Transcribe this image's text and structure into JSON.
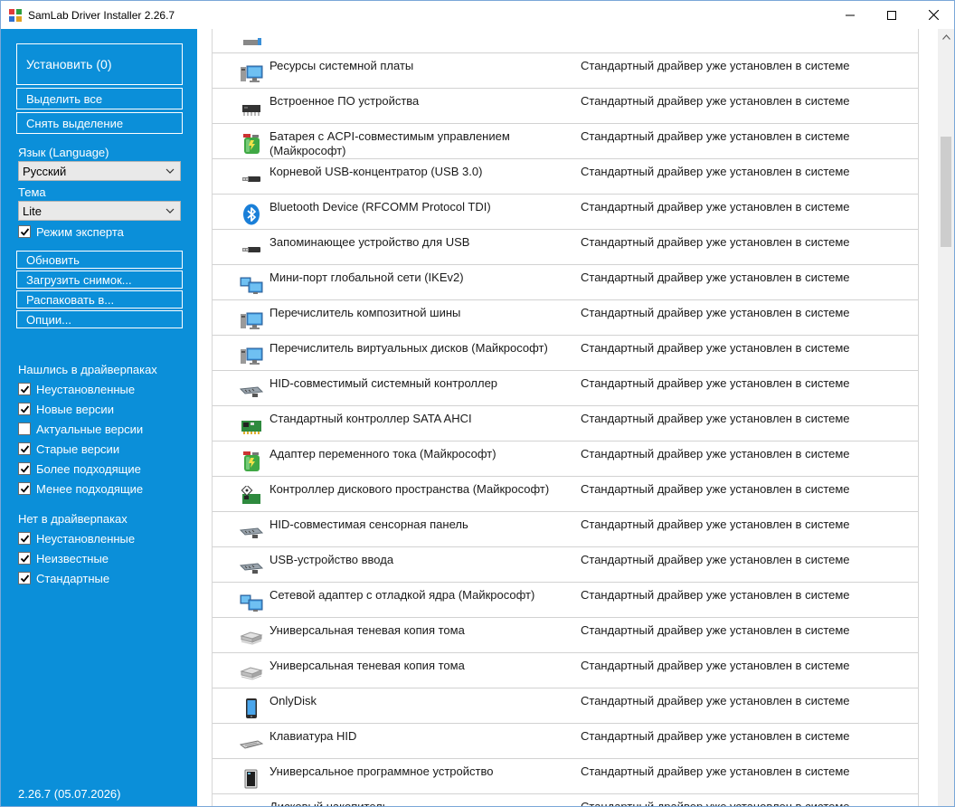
{
  "window": {
    "title": "SamLab Driver Installer 2.26.7"
  },
  "sidebar": {
    "install_label": "Установить (0)",
    "select_all_label": "Выделить все",
    "deselect_label": "Снять выделение",
    "language_label": "Язык (Language)",
    "language_value": "Русский",
    "theme_label": "Тема",
    "theme_value": "Lite",
    "expert_mode_label": "Режим эксперта",
    "refresh_label": "Обновить",
    "load_snapshot_label": "Загрузить снимок...",
    "extract_label": "Распаковать в...",
    "options_label": "Опции...",
    "found_header": "Нашлись в драйверпаках",
    "found_filters": [
      {
        "label": "Неустановленные",
        "checked": true
      },
      {
        "label": "Новые версии",
        "checked": true
      },
      {
        "label": "Актуальные версии",
        "checked": false
      },
      {
        "label": "Старые версии",
        "checked": true
      },
      {
        "label": "Более подходящие",
        "checked": true
      },
      {
        "label": "Менее подходящие",
        "checked": true
      }
    ],
    "notfound_header": "Нет в драйверпаках",
    "notfound_filters": [
      {
        "label": "Неустановленные",
        "checked": true
      },
      {
        "label": "Неизвестные",
        "checked": true
      },
      {
        "label": "Стандартные",
        "checked": true
      }
    ],
    "version": "2.26.7 (05.07.2026)"
  },
  "colors": {
    "sidebar_bg": "#0b8fd9",
    "row_border": "#d2d2d2"
  },
  "devices": [
    {
      "icon": "generic-device-icon",
      "name": "",
      "status": ""
    },
    {
      "icon": "computer-icon",
      "name": "Ресурсы системной платы",
      "status": "Стандартный драйвер уже установлен в системе"
    },
    {
      "icon": "chip-icon",
      "name": "Встроенное ПО устройства",
      "status": "Стандартный драйвер уже установлен в системе"
    },
    {
      "icon": "battery-icon",
      "name": "Батарея с ACPI-совместимым управлением (Майкрософт)",
      "status": "Стандартный драйвер уже установлен в системе"
    },
    {
      "icon": "usb-icon",
      "name": "Корневой USB-концентратор (USB 3.0)",
      "status": "Стандартный драйвер уже установлен в системе"
    },
    {
      "icon": "bluetooth-icon",
      "name": "Bluetooth Device (RFCOMM Protocol TDI)",
      "status": "Стандартный драйвер уже установлен в системе"
    },
    {
      "icon": "usb-icon",
      "name": "Запоминающее устройство для USB",
      "status": "Стандартный драйвер уже установлен в системе"
    },
    {
      "icon": "network-icon",
      "name": "Мини-порт глобальной сети (IKEv2)",
      "status": "Стандартный драйвер уже установлен в системе"
    },
    {
      "icon": "computer-icon",
      "name": "Перечислитель композитной шины",
      "status": "Стандартный драйвер уже установлен в системе"
    },
    {
      "icon": "computer-icon",
      "name": "Перечислитель виртуальных дисков (Майкрософт)",
      "status": "Стандартный драйвер уже установлен в системе"
    },
    {
      "icon": "hid-icon",
      "name": "HID-совместимый системный контроллер",
      "status": "Стандартный драйвер уже установлен в системе"
    },
    {
      "icon": "storage-controller-icon",
      "name": "Стандартный контроллер SATA AHCI",
      "status": "Стандартный драйвер уже установлен в системе"
    },
    {
      "icon": "battery-icon",
      "name": "Адаптер переменного тока (Майкрософт)",
      "status": "Стандартный драйвер уже установлен в системе"
    },
    {
      "icon": "disk-space-controller-icon",
      "name": "Контроллер дискового пространства (Майкрософт)",
      "status": "Стандартный драйвер уже установлен в системе"
    },
    {
      "icon": "hid-icon",
      "name": "HID-совместимая сенсорная панель",
      "status": "Стандартный драйвер уже установлен в системе"
    },
    {
      "icon": "hid-icon",
      "name": "USB-устройство ввода",
      "status": "Стандартный драйвер уже установлен в системе"
    },
    {
      "icon": "network-icon",
      "name": "Сетевой адаптер с отладкой ядра (Майкрософт)",
      "status": "Стандартный драйвер уже установлен в системе"
    },
    {
      "icon": "volume-icon",
      "name": "Универсальная теневая копия тома",
      "status": "Стандартный драйвер уже установлен в системе"
    },
    {
      "icon": "volume-icon",
      "name": "Универсальная теневая копия тома",
      "status": "Стандартный драйвер уже установлен в системе"
    },
    {
      "icon": "portable-device-icon",
      "name": "OnlyDisk",
      "status": "Стандартный драйвер уже установлен в системе"
    },
    {
      "icon": "keyboard-icon",
      "name": "Клавиатура HID",
      "status": "Стандартный драйвер уже установлен в системе"
    },
    {
      "icon": "software-device-icon",
      "name": "Универсальное программное устройство",
      "status": "Стандартный драйвер уже установлен в системе"
    },
    {
      "icon": "disk-drive-icon",
      "name": "Дисковый накопитель",
      "status": "Стандартный драйвер уже установлен в системе"
    }
  ]
}
